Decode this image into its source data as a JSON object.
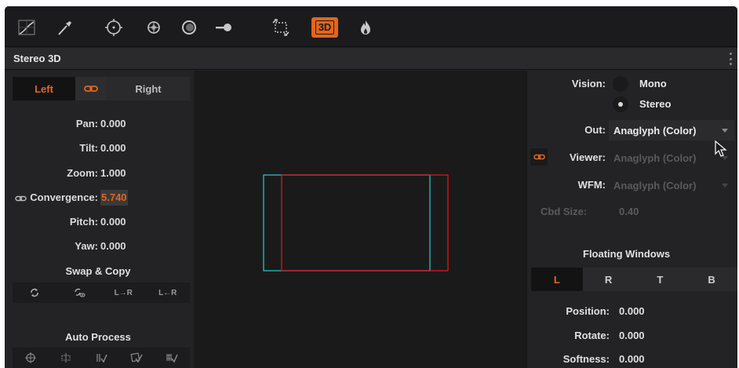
{
  "toolbar": {
    "tools": [
      "curves-icon",
      "qualifier-picker-icon",
      "window-icon",
      "tracker-icon",
      "blur-icon",
      "key-icon",
      "sizing-icon",
      "stereo-3d-icon",
      "magic-icon"
    ],
    "active_label": "3D"
  },
  "panel": {
    "title": "Stereo 3D"
  },
  "eye_segment": {
    "left_label": "Left",
    "right_label": "Right"
  },
  "params": {
    "pan": {
      "label": "Pan:",
      "value": "0.000"
    },
    "tilt": {
      "label": "Tilt:",
      "value": "0.000"
    },
    "zoom": {
      "label": "Zoom:",
      "value": "1.000"
    },
    "convergence": {
      "label": "Convergence:",
      "value": "5.740"
    },
    "pitch": {
      "label": "Pitch:",
      "value": "0.000"
    },
    "yaw": {
      "label": "Yaw:",
      "value": "0.000"
    }
  },
  "swap_copy": {
    "title": "Swap & Copy",
    "buttons": [
      "swap-icon",
      "swap-view-icon",
      "L→R",
      "L←R"
    ]
  },
  "auto_process": {
    "title": "Auto Process"
  },
  "vision": {
    "label": "Vision:",
    "options": [
      "Mono",
      "Stereo"
    ],
    "selected": "Stereo"
  },
  "outputs": {
    "out": {
      "label": "Out:",
      "value": "Anaglyph (Color)"
    },
    "viewer": {
      "label": "Viewer:",
      "value": "Anaglyph (Color)"
    },
    "wfm": {
      "label": "WFM:",
      "value": "Anaglyph (Color)"
    },
    "cbd_size": {
      "label": "Cbd Size:",
      "value": "0.40"
    }
  },
  "floating_windows": {
    "title": "Floating Windows",
    "tabs": [
      "L",
      "R",
      "T",
      "B"
    ],
    "selected": "L",
    "position": {
      "label": "Position:",
      "value": "0.000"
    },
    "rotate": {
      "label": "Rotate:",
      "value": "0.000"
    },
    "softness": {
      "label": "Softness:",
      "value": "0.000"
    }
  },
  "colors": {
    "accent": "#e4651b",
    "cyan": "#1fb8b8",
    "red": "#d01818"
  }
}
